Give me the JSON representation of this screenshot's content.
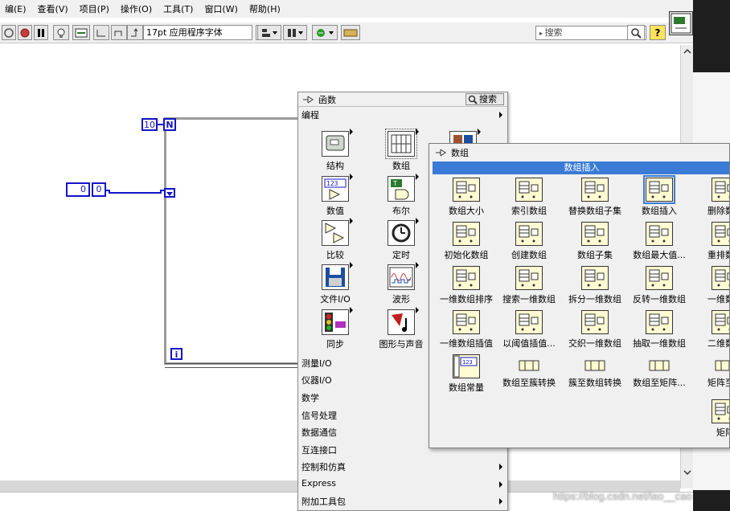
{
  "menu": [
    "编(E)",
    "查看(V)",
    "项目(P)",
    "操作(O)",
    "工具(T)",
    "窗口(W)",
    "帮助(H)"
  ],
  "toolbar": {
    "font_label": "17pt 应用程序字体",
    "search_placeholder": "搜索"
  },
  "diagram": {
    "count_value": "10",
    "count_label": "N",
    "index_label": "i",
    "numeric_value": "0",
    "array_value": "0"
  },
  "palette": {
    "title": "函数",
    "search_label": "搜索",
    "section_top": "编程",
    "items": [
      {
        "label": "结构"
      },
      {
        "label": "数组"
      },
      {
        "label": ""
      },
      {
        "label": "数值"
      },
      {
        "label": "布尔"
      },
      {
        "label": "比较"
      },
      {
        "label": "定时"
      },
      {
        "label": "文件I/O"
      },
      {
        "label": "波形"
      },
      {
        "label": "同步"
      },
      {
        "label": "图形与声音"
      }
    ],
    "sections": [
      {
        "label": "测量I/O",
        "arrow": false
      },
      {
        "label": "仪器I/O",
        "arrow": false
      },
      {
        "label": "数学",
        "arrow": false
      },
      {
        "label": "信号处理",
        "arrow": false
      },
      {
        "label": "数据通信",
        "arrow": false
      },
      {
        "label": "互连接口",
        "arrow": false
      },
      {
        "label": "控制和仿真",
        "arrow": true
      },
      {
        "label": "Express",
        "arrow": true
      },
      {
        "label": "附加工具包",
        "arrow": true
      }
    ]
  },
  "array_palette": {
    "title": "数组",
    "tooltip": "数组插入",
    "rows": [
      [
        "数组大小",
        "索引数组",
        "替换数组子集",
        "数组插入",
        "删除数组"
      ],
      [
        "初始化数组",
        "创建数组",
        "数组子集",
        "数组最大值...",
        "重排数组"
      ],
      [
        "一维数组排序",
        "搜索一维数组",
        "拆分一维数组",
        "反转一维数组",
        "一维数组"
      ],
      [
        "一维数组插值",
        "以阈值插值...",
        "交织一维数组",
        "抽取一维数组",
        "二维数组"
      ],
      [
        "数组常量",
        "数组至簇转换",
        "簇至数组转换",
        "数组至矩阵...",
        "矩阵至数"
      ],
      [
        "",
        "",
        "",
        "",
        "矩阵"
      ]
    ]
  },
  "watermark": "https://blog.csdn.net/lao__cao"
}
